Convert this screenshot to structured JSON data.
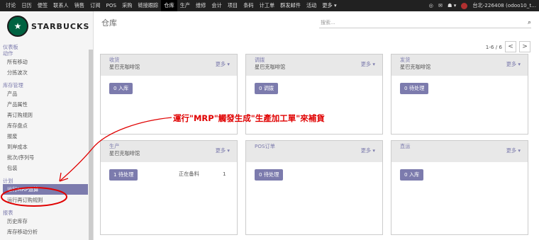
{
  "topbar": {
    "menus": [
      "讨论",
      "日历",
      "便签",
      "联系人",
      "销售",
      "订阅",
      "POS",
      "采购",
      "链接跟踪",
      "仓库",
      "生产",
      "维修",
      "会计",
      "项目",
      "条码",
      "计工单",
      "群发邮件",
      "活动",
      "更多 ▾"
    ],
    "active_menu": "仓库",
    "right_items": [
      "◎",
      "✉",
      "☗ ▾"
    ],
    "user_label": "台北-226408 (odoo10_t..."
  },
  "brand": {
    "logo_text": "STARBUCKS",
    "logo_glyph": "★",
    "logo_color": "#006241"
  },
  "sidebar": {
    "groups": [
      {
        "header": "仪表板",
        "items": []
      },
      {
        "header": "动作",
        "items": [
          "所有移动",
          "分拣波次"
        ]
      },
      {
        "header": "库存管理",
        "items": [
          "产品",
          "产品属性",
          "再订购规则",
          "库存盘点",
          "报废",
          "到岸成本",
          "批次/序列号",
          "包装"
        ]
      },
      {
        "header": "计划",
        "items": [
          "运行MRP运算",
          "运行再订购规则"
        ]
      },
      {
        "header": "报表",
        "items": [
          "历史库存",
          "库存移动分析"
        ]
      }
    ],
    "active_item": "运行MRP运算"
  },
  "main": {
    "title": "仓库",
    "search_placeholder": "搜索...",
    "pager_text": "1-6 / 6",
    "prev": "<",
    "next": ">"
  },
  "cards": [
    {
      "name": "收货",
      "warehouse": "星巴克咖啡馆",
      "more": "更多 ▾",
      "action": "0 入库"
    },
    {
      "name": "调拨",
      "warehouse": "星巴克咖啡馆",
      "more": "更多 ▾",
      "action": "0 调拨"
    },
    {
      "name": "发货",
      "warehouse": "星巴克咖啡馆",
      "more": "更多 ▾",
      "action": "0 待处理"
    },
    {
      "name": "生产",
      "warehouse": "星巴克咖啡馆",
      "more": "更多 ▾",
      "action": "1 待处理",
      "stat_label": "正在备料",
      "stat_value": "1"
    },
    {
      "name": "POS订单",
      "warehouse": "",
      "more": "更多 ▾",
      "action": "0 待处理"
    },
    {
      "name": "直运",
      "warehouse": "",
      "more": "更多 ▾",
      "action": "0 入库"
    }
  ],
  "annotation": {
    "text": "運行\"MRP\"觸發生成\"生產加工單\"來補貨",
    "color": "#e00000"
  }
}
